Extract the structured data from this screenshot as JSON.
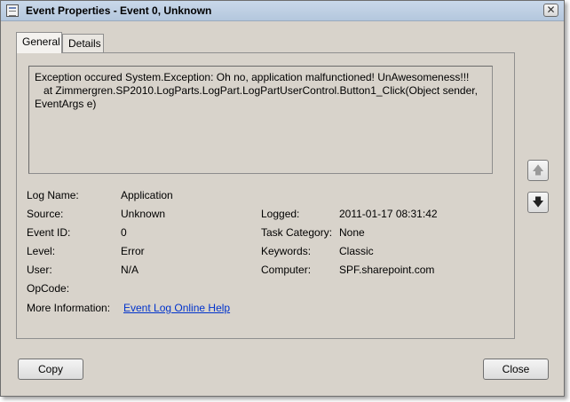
{
  "window": {
    "title": "Event Properties - Event 0, Unknown",
    "close_glyph": "✕"
  },
  "tabs": [
    {
      "label": "General"
    },
    {
      "label": "Details"
    }
  ],
  "description": "Exception occured System.Exception: Oh no, application malfunctioned! UnAwesomeness!!!\n   at Zimmergren.SP2010.LogParts.LogPart.LogPartUserControl.Button1_Click(Object sender,\nEventArgs e)",
  "fields": {
    "log_name": {
      "label": "Log Name:",
      "value": "Application"
    },
    "source": {
      "label": "Source:",
      "value": "Unknown"
    },
    "event_id": {
      "label": "Event ID:",
      "value": "0"
    },
    "level": {
      "label": "Level:",
      "value": "Error"
    },
    "user": {
      "label": "User:",
      "value": "N/A"
    },
    "opcode": {
      "label": "OpCode:",
      "value": ""
    },
    "more_info": {
      "label": "More Information:",
      "value": "Event Log Online Help"
    },
    "logged": {
      "label": "Logged:",
      "value": "2011-01-17 08:31:42"
    },
    "task_category": {
      "label": "Task Category:",
      "value": "None"
    },
    "keywords": {
      "label": "Keywords:",
      "value": "Classic"
    },
    "computer": {
      "label": "Computer:",
      "value": "SPF.sharepoint.com"
    }
  },
  "nav": {
    "up_glyph": "🡅",
    "down_glyph": "🡇"
  },
  "buttons": {
    "copy": "Copy",
    "close": "Close"
  }
}
